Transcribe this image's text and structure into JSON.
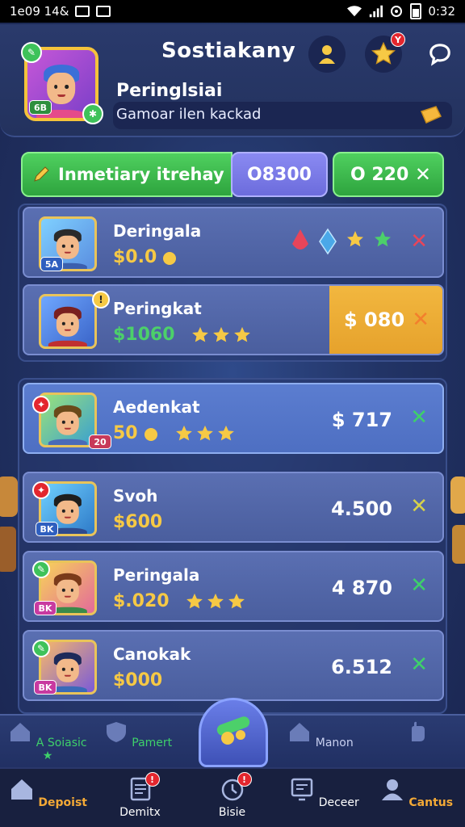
{
  "status_bar": {
    "time_left": "1e09 14&",
    "time_right": "0:32"
  },
  "header": {
    "title": "Sostiakany",
    "profile_name": "Peringlsiai",
    "profile_sub": "Gamoar ilen kackad",
    "avatar_level": "6B",
    "notification_count": "Y"
  },
  "action_bar": {
    "primary_label": "Inmetiary itrehay",
    "mid_value": "O8300",
    "right_value": "O 220"
  },
  "rows": [
    {
      "name": "Deringala",
      "coins": "$0.0",
      "level": "5A",
      "price": "",
      "gems": [
        "#e8455a",
        "#4aa8e8",
        "#f6c945",
        "#4cd06a"
      ],
      "close_color": "#e8455a"
    },
    {
      "name": "Peringkat",
      "coins": "$1060",
      "level": "",
      "price": "$ 080",
      "close_color": "#f37f2c"
    },
    {
      "name": "Aedenkat",
      "coins": "50",
      "level": "20",
      "price": "$ 717",
      "close_color": "#3ed06a"
    },
    {
      "name": "Svoh",
      "coins": "$600",
      "level": "BK",
      "price": "4.500",
      "close_color": "#d6d24a"
    },
    {
      "name": "Peringala",
      "coins": "$.020",
      "level": "BK",
      "price": "4 870",
      "close_color": "#3ed06a"
    },
    {
      "name": "Canokak",
      "coins": "$000",
      "level": "BK",
      "price": "6.512",
      "close_color": "#3ed06a"
    }
  ],
  "sub_nav": {
    "left": "A Soiasic ★",
    "left_mid": "Pamert",
    "right_mid": "Manon"
  },
  "bottom_nav": {
    "items": [
      {
        "label": "Depoist",
        "badge": ""
      },
      {
        "label": "Demitx",
        "badge": "!"
      },
      {
        "label": "Bisie",
        "badge": "!"
      },
      {
        "label": "Deceer",
        "badge": ""
      },
      {
        "label": "Cantus",
        "badge": ""
      }
    ]
  },
  "colors": {
    "accent_green": "#2ea43e",
    "accent_purple": "#6c6cdc",
    "accent_gold": "#f2b73f",
    "coin_gold": "#f6c945",
    "badge_red": "#e3262e"
  }
}
